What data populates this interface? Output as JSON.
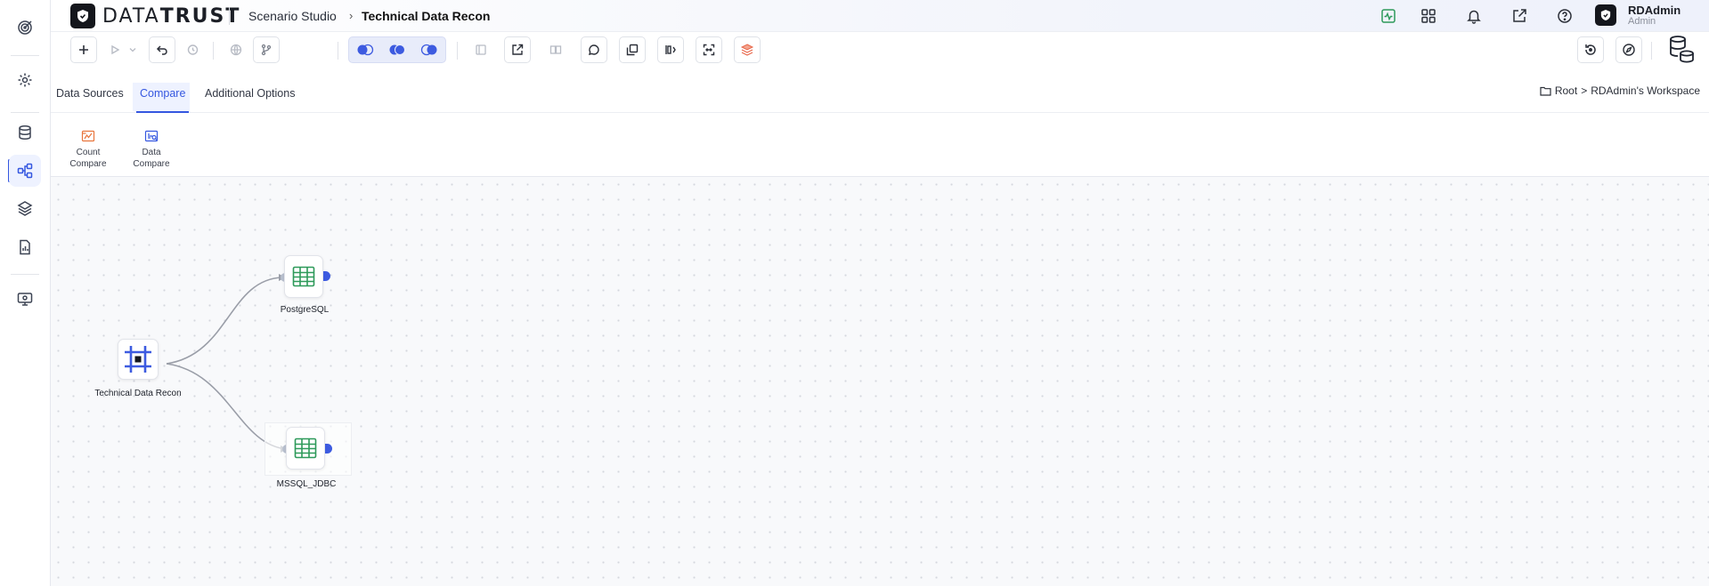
{
  "header": {
    "logo_text_light": "DATA",
    "logo_text_bold": "TRUST",
    "breadcrumb_parent": "Scenario Studio",
    "breadcrumb_current": "Technical Data Recon",
    "user_name": "RDAdmin",
    "user_role": "Admin",
    "icons": [
      "activity-icon",
      "apps-grid-icon",
      "bell-icon",
      "external-link-icon",
      "help-icon"
    ]
  },
  "sidebar": {
    "items": [
      "target-icon",
      "settings-icon",
      "database-icon",
      "workflow-icon",
      "layers-icon",
      "report-icon",
      "monitor-settings-icon"
    ],
    "active": "workflow-icon"
  },
  "toolbar": {
    "buttons": [
      "add",
      "run",
      "run-options",
      "undo",
      "history",
      "globe",
      "branch",
      "join-left",
      "join-inner",
      "join-right",
      "panel",
      "export",
      "compare",
      "comment",
      "duplicate",
      "align",
      "fit-view",
      "layers",
      "reset",
      "explore"
    ]
  },
  "tabs": {
    "items": [
      "Data Sources",
      "Compare",
      "Additional Options"
    ],
    "active": "Compare"
  },
  "workspace": {
    "root": "Root",
    "separator": ">",
    "name": "RDAdmin's Workspace"
  },
  "palette": {
    "count_compare_line1": "Count",
    "count_compare_line2": "Compare",
    "data_compare_line1": "Data",
    "data_compare_line2": "Compare"
  },
  "canvas": {
    "nodes": [
      {
        "id": "recon",
        "label": "Technical Data Recon"
      },
      {
        "id": "pg",
        "label": "PostgreSQL"
      },
      {
        "id": "mssql",
        "label": "MSSQL_JDBC"
      }
    ]
  },
  "colors": {
    "accent": "#3557e0",
    "node_table_icon": "#2e9a5a",
    "palette_count_icon": "#e8743b",
    "palette_data_icon": "#3557e0"
  }
}
